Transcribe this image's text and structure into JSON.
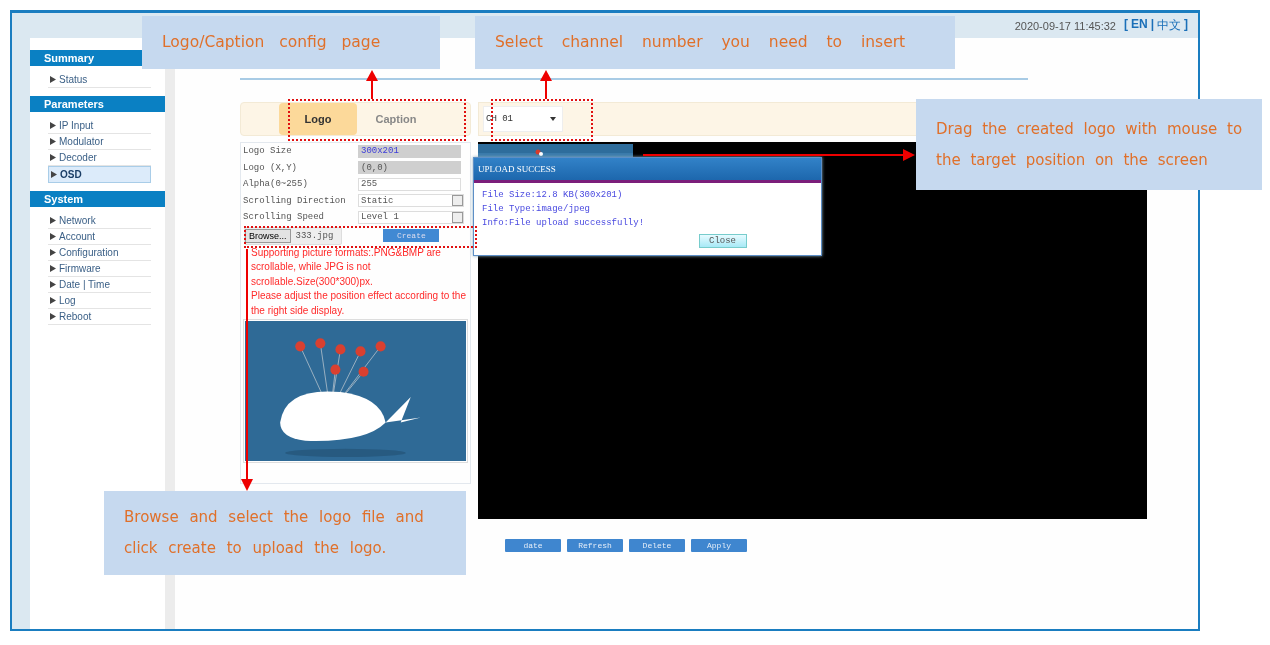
{
  "top_bar": {
    "datetime": "2020-09-17 11:45:32",
    "language_switch": {
      "open": "[",
      "separator": "|",
      "close": "]",
      "items": [
        {
          "label": "EN",
          "selected": true
        },
        {
          "label": "中文",
          "selected": false
        }
      ]
    }
  },
  "sidebar": {
    "sections": [
      {
        "title": "Summary",
        "items": [
          {
            "label": "Status",
            "selected": false
          }
        ]
      },
      {
        "title": "Parameters",
        "items": [
          {
            "label": "IP Input",
            "selected": false
          },
          {
            "label": "Modulator",
            "selected": false
          },
          {
            "label": "Decoder",
            "selected": false
          },
          {
            "label": "OSD",
            "selected": true
          }
        ]
      },
      {
        "title": "System",
        "items": [
          {
            "label": "Network",
            "selected": false
          },
          {
            "label": "Account",
            "selected": false
          },
          {
            "label": "Configuration",
            "selected": false
          },
          {
            "label": "Firmware",
            "selected": false
          },
          {
            "label": "Date | Time",
            "selected": false
          },
          {
            "label": "Log",
            "selected": false
          },
          {
            "label": "Reboot",
            "selected": false
          }
        ]
      }
    ]
  },
  "tabs": [
    {
      "label": "Logo",
      "selected": true
    },
    {
      "label": "Caption",
      "selected": false
    }
  ],
  "channel_select": {
    "value": "CH 01"
  },
  "fields": [
    {
      "label": "Logo Size",
      "value": "300x201",
      "kind": "readonly"
    },
    {
      "label": "Logo (X,Y)",
      "value": "(0,0)",
      "kind": "readonly"
    },
    {
      "label": "Alpha(0~255)",
      "value": "255",
      "kind": "input"
    },
    {
      "label": "Scrolling Direction",
      "value": "Static",
      "kind": "select"
    },
    {
      "label": "Scrolling Speed",
      "value": "Level 1",
      "kind": "select"
    }
  ],
  "upload": {
    "browse_button": "Browse...",
    "filename": "333.jpg",
    "create_button": "Create"
  },
  "notes": [
    "Supporting picture formats:.PNG&BMP are scrollable, while JPG is not scrollable.Size(300*300)px.",
    "Please adjust the position effect according to the the right side display."
  ],
  "dialog": {
    "title": "UPLOAD SUCCESS",
    "lines": [
      "File Size:12.8 KB(300x201)",
      "File Type:image/jpeg",
      "Info:File upload successfully!"
    ],
    "close_button": "Close"
  },
  "buttons": [
    "date",
    "Refresh",
    "Delete",
    "Apply"
  ],
  "callouts": [
    "Logo/Caption config page",
    "Select channel number you need to insert",
    "Drag the created logo with mouse to the target position on the screen",
    "Browse and select the logo file and click create to upload the logo."
  ]
}
